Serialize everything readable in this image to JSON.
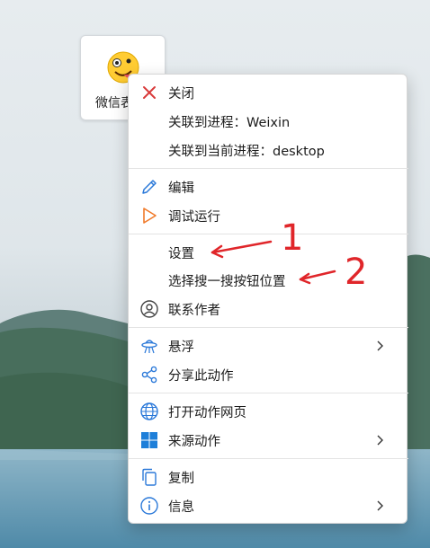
{
  "desktop_icon": {
    "label": "微信表"
  },
  "menu": {
    "items": [
      {
        "label": "关闭",
        "icon": "close-icon"
      },
      {
        "label": "关联到进程：Weixin",
        "icon": ""
      },
      {
        "label": "关联到当前进程：desktop",
        "icon": ""
      },
      {
        "label": "编辑",
        "icon": "pencil-icon"
      },
      {
        "label": "调试运行",
        "icon": "play-icon"
      },
      {
        "label": "设置",
        "icon": ""
      },
      {
        "label": "选择搜一搜按钮位置",
        "icon": ""
      },
      {
        "label": "联系作者",
        "icon": "user-icon"
      },
      {
        "label": "悬浮",
        "icon": "ufo-icon",
        "submenu": true
      },
      {
        "label": "分享此动作",
        "icon": "share-icon"
      },
      {
        "label": "打开动作网页",
        "icon": "globe-icon"
      },
      {
        "label": "来源动作",
        "icon": "windows-icon",
        "submenu": true
      },
      {
        "label": "复制",
        "icon": "copy-icon"
      },
      {
        "label": "信息",
        "icon": "info-icon",
        "submenu": true
      }
    ]
  },
  "annotations": {
    "num1": "1",
    "num2": "2"
  },
  "colors": {
    "accent": "#2b79d9",
    "close": "#d93a3a",
    "play": "#f07a2a",
    "annotation": "#e0262a"
  }
}
